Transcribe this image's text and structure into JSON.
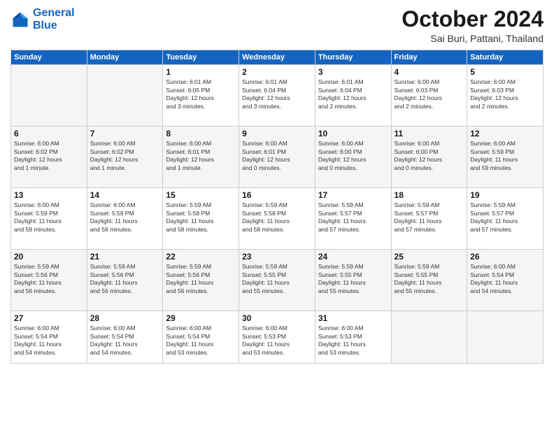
{
  "header": {
    "logo_line1": "General",
    "logo_line2": "Blue",
    "month_title": "October 2024",
    "location": "Sai Buri, Pattani, Thailand"
  },
  "weekdays": [
    "Sunday",
    "Monday",
    "Tuesday",
    "Wednesday",
    "Thursday",
    "Friday",
    "Saturday"
  ],
  "weeks": [
    [
      {
        "day": "",
        "info": ""
      },
      {
        "day": "",
        "info": ""
      },
      {
        "day": "1",
        "info": "Sunrise: 6:01 AM\nSunset: 6:05 PM\nDaylight: 12 hours\nand 3 minutes."
      },
      {
        "day": "2",
        "info": "Sunrise: 6:01 AM\nSunset: 6:04 PM\nDaylight: 12 hours\nand 3 minutes."
      },
      {
        "day": "3",
        "info": "Sunrise: 6:01 AM\nSunset: 6:04 PM\nDaylight: 12 hours\nand 2 minutes."
      },
      {
        "day": "4",
        "info": "Sunrise: 6:00 AM\nSunset: 6:03 PM\nDaylight: 12 hours\nand 2 minutes."
      },
      {
        "day": "5",
        "info": "Sunrise: 6:00 AM\nSunset: 6:03 PM\nDaylight: 12 hours\nand 2 minutes."
      }
    ],
    [
      {
        "day": "6",
        "info": "Sunrise: 6:00 AM\nSunset: 6:02 PM\nDaylight: 12 hours\nand 1 minute."
      },
      {
        "day": "7",
        "info": "Sunrise: 6:00 AM\nSunset: 6:02 PM\nDaylight: 12 hours\nand 1 minute."
      },
      {
        "day": "8",
        "info": "Sunrise: 6:00 AM\nSunset: 6:01 PM\nDaylight: 12 hours\nand 1 minute."
      },
      {
        "day": "9",
        "info": "Sunrise: 6:00 AM\nSunset: 6:01 PM\nDaylight: 12 hours\nand 0 minutes."
      },
      {
        "day": "10",
        "info": "Sunrise: 6:00 AM\nSunset: 6:00 PM\nDaylight: 12 hours\nand 0 minutes."
      },
      {
        "day": "11",
        "info": "Sunrise: 6:00 AM\nSunset: 6:00 PM\nDaylight: 12 hours\nand 0 minutes."
      },
      {
        "day": "12",
        "info": "Sunrise: 6:00 AM\nSunset: 5:59 PM\nDaylight: 11 hours\nand 59 minutes."
      }
    ],
    [
      {
        "day": "13",
        "info": "Sunrise: 6:00 AM\nSunset: 5:59 PM\nDaylight: 11 hours\nand 59 minutes."
      },
      {
        "day": "14",
        "info": "Sunrise: 6:00 AM\nSunset: 5:59 PM\nDaylight: 11 hours\nand 58 minutes."
      },
      {
        "day": "15",
        "info": "Sunrise: 5:59 AM\nSunset: 5:58 PM\nDaylight: 11 hours\nand 58 minutes."
      },
      {
        "day": "16",
        "info": "Sunrise: 5:59 AM\nSunset: 5:58 PM\nDaylight: 11 hours\nand 58 minutes."
      },
      {
        "day": "17",
        "info": "Sunrise: 5:59 AM\nSunset: 5:57 PM\nDaylight: 11 hours\nand 57 minutes."
      },
      {
        "day": "18",
        "info": "Sunrise: 5:59 AM\nSunset: 5:57 PM\nDaylight: 11 hours\nand 57 minutes."
      },
      {
        "day": "19",
        "info": "Sunrise: 5:59 AM\nSunset: 5:57 PM\nDaylight: 11 hours\nand 57 minutes."
      }
    ],
    [
      {
        "day": "20",
        "info": "Sunrise: 5:59 AM\nSunset: 5:56 PM\nDaylight: 11 hours\nand 56 minutes."
      },
      {
        "day": "21",
        "info": "Sunrise: 5:59 AM\nSunset: 5:56 PM\nDaylight: 11 hours\nand 56 minutes."
      },
      {
        "day": "22",
        "info": "Sunrise: 5:59 AM\nSunset: 5:56 PM\nDaylight: 11 hours\nand 56 minutes."
      },
      {
        "day": "23",
        "info": "Sunrise: 5:59 AM\nSunset: 5:55 PM\nDaylight: 11 hours\nand 55 minutes."
      },
      {
        "day": "24",
        "info": "Sunrise: 5:59 AM\nSunset: 5:55 PM\nDaylight: 11 hours\nand 55 minutes."
      },
      {
        "day": "25",
        "info": "Sunrise: 5:59 AM\nSunset: 5:55 PM\nDaylight: 11 hours\nand 55 minutes."
      },
      {
        "day": "26",
        "info": "Sunrise: 6:00 AM\nSunset: 5:54 PM\nDaylight: 11 hours\nand 54 minutes."
      }
    ],
    [
      {
        "day": "27",
        "info": "Sunrise: 6:00 AM\nSunset: 5:54 PM\nDaylight: 11 hours\nand 54 minutes."
      },
      {
        "day": "28",
        "info": "Sunrise: 6:00 AM\nSunset: 5:54 PM\nDaylight: 11 hours\nand 54 minutes."
      },
      {
        "day": "29",
        "info": "Sunrise: 6:00 AM\nSunset: 5:54 PM\nDaylight: 11 hours\nand 53 minutes."
      },
      {
        "day": "30",
        "info": "Sunrise: 6:00 AM\nSunset: 5:53 PM\nDaylight: 11 hours\nand 53 minutes."
      },
      {
        "day": "31",
        "info": "Sunrise: 6:00 AM\nSunset: 5:53 PM\nDaylight: 11 hours\nand 53 minutes."
      },
      {
        "day": "",
        "info": ""
      },
      {
        "day": "",
        "info": ""
      }
    ]
  ]
}
